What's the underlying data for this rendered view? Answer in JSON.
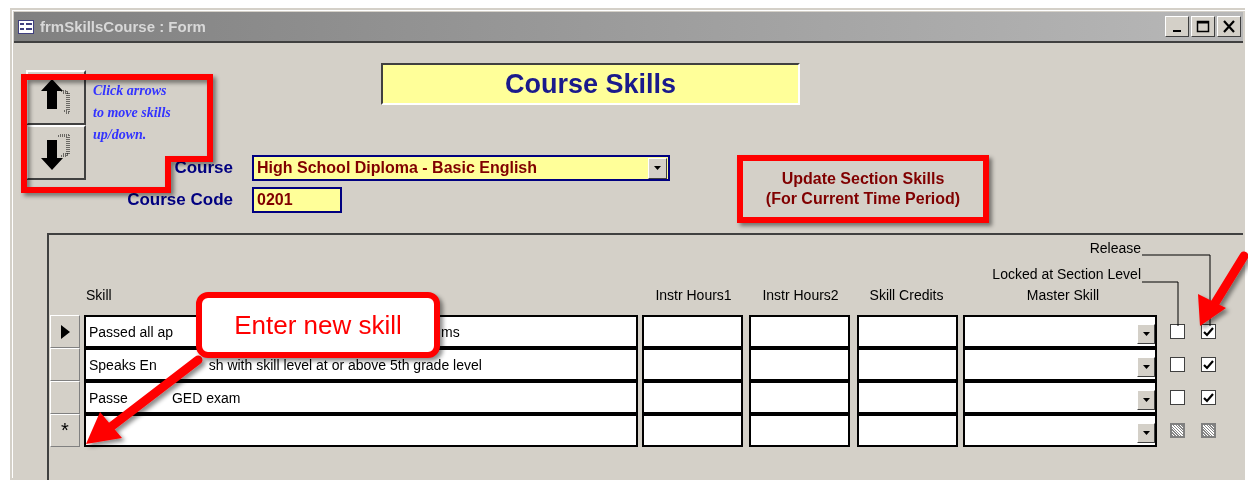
{
  "window": {
    "title": "frmSkillsCourse : Form"
  },
  "nav": {
    "hint": "Click arrows\nto move skills\nup/down."
  },
  "title": "Course Skills",
  "fields": [
    {
      "label": "Course",
      "value": "High School Diploma - Basic English",
      "kind": "combo"
    },
    {
      "label": "Course Code",
      "value": "0201",
      "kind": "text"
    }
  ],
  "update_button": "Update Section Skills\n(For Current Time Period)",
  "subform": {
    "group_labels": [
      "Release",
      "Locked at Section Level"
    ],
    "columns": [
      "Skill",
      "Instr Hours1",
      "Instr Hours2",
      "Skill Credits",
      "Master Skill"
    ],
    "rows": [
      {
        "kind": "current",
        "skill": [
          "Passed all ap",
          "ms"
        ],
        "locked": false,
        "release": true
      },
      {
        "kind": "normal",
        "skill": [
          "Speaks En",
          "sh with skill level at or above 5th grade level"
        ],
        "locked": false,
        "release": true
      },
      {
        "kind": "normal",
        "skill": [
          "Passe",
          "GED exam"
        ],
        "locked": false,
        "release": true
      },
      {
        "kind": "new",
        "marker": "*",
        "locked": null,
        "release": null
      }
    ]
  },
  "callout": "Enter new skill"
}
